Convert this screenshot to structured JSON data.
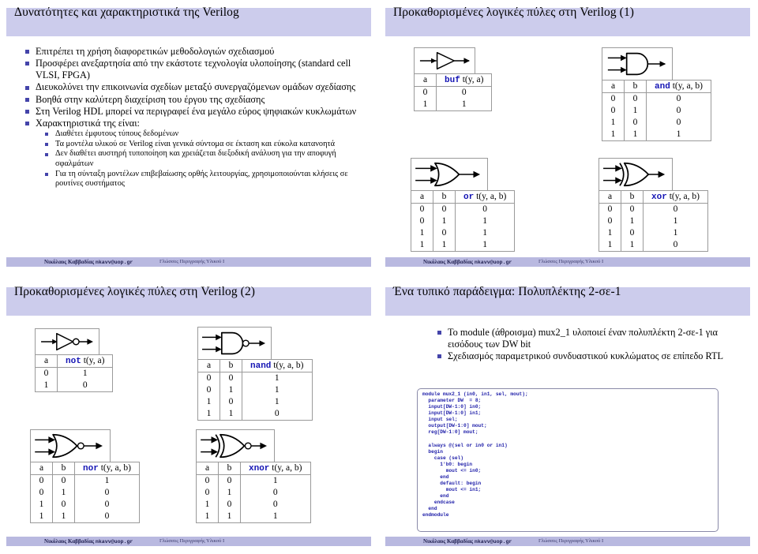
{
  "footer": {
    "author": "Νικόλαος Καββαδίας",
    "email": "nkavv@uop.gr",
    "course": "Γλώσσες Περιγραφής Υλικού Ι"
  },
  "colors": {
    "title_bar": "#ccccec",
    "footer_bar": "#b9b9e0",
    "bullet": "#4444aa",
    "keyword": "#1414b4",
    "code_text": "#2222aa",
    "table_border": "#9a9a9a"
  },
  "slides": [
    {
      "id": "slide-1",
      "title": "Δυνατότητες και χαρακτηριστικά της Verilog",
      "bullets": [
        {
          "level": 1,
          "text": "Επιτρέπει τη χρήση διαφορετικών μεθοδολογιών σχεδιασμού"
        },
        {
          "level": 1,
          "text": "Προσφέρει ανεξαρτησία από την εκάστοτε τεχνολογία υλοποίησης (standard cell VLSI, FPGA)"
        },
        {
          "level": 1,
          "text": "Διευκολύνει την επικοινωνία σχεδίων μεταξύ συνεργαζόμενων ομάδων σχεδίασης"
        },
        {
          "level": 1,
          "text": "Βοηθά στην καλύτερη διαχείριση του έργου της σχεδίασης"
        },
        {
          "level": 1,
          "text": "Στη Verilog HDL μπορεί να περιγραφεί ένα μεγάλο εύρος ψηφιακών κυκλωμάτων"
        },
        {
          "level": 1,
          "text": "Χαρακτηριστικά της είναι:"
        },
        {
          "level": 2,
          "text": "Διαθέτει έμφυτους τύπους δεδομένων"
        },
        {
          "level": 2,
          "text": "Τα μοντέλα υλικού σε Verilog είναι γενικά σύντομα σε έκταση και εύκολα κατανοητά"
        },
        {
          "level": 2,
          "text": "Δεν διαθέτει αυστηρή τυποποίηση και χρειάζεται διεξοδική ανάλυση για την αποφυγή σφαλμάτων"
        },
        {
          "level": 2,
          "text": "Για τη σύνταξη μοντέλων επιβεβαίωσης ορθής λειτουργίας, χρησιμοποιούνται κλήσεις σε ρουτίνες συστήματος"
        }
      ]
    },
    {
      "id": "slide-2",
      "title": "Προκαθορισμένες λογικές πύλες στη Verilog (1)",
      "gates": [
        {
          "name": "buf",
          "shape": "buffer",
          "inputs": 1,
          "header": [
            "a",
            "buf t(y, a)"
          ],
          "keyword": "buf",
          "signature": " t(y, a)",
          "rows": [
            [
              "0",
              "0"
            ],
            [
              "1",
              "1"
            ]
          ]
        },
        {
          "name": "and",
          "shape": "and",
          "inputs": 2,
          "header": [
            "a",
            "b",
            "and t(y, a, b)"
          ],
          "keyword": "and",
          "signature": " t(y, a, b)",
          "rows": [
            [
              "0",
              "0",
              "0"
            ],
            [
              "0",
              "1",
              "0"
            ],
            [
              "1",
              "0",
              "0"
            ],
            [
              "1",
              "1",
              "1"
            ]
          ]
        },
        {
          "name": "or",
          "shape": "or",
          "inputs": 2,
          "header": [
            "a",
            "b",
            "or t(y, a, b)"
          ],
          "keyword": "or",
          "signature": " t(y, a, b)",
          "rows": [
            [
              "0",
              "0",
              "0"
            ],
            [
              "0",
              "1",
              "1"
            ],
            [
              "1",
              "0",
              "1"
            ],
            [
              "1",
              "1",
              "1"
            ]
          ]
        },
        {
          "name": "xor",
          "shape": "xor",
          "inputs": 2,
          "header": [
            "a",
            "b",
            "xor t(y, a, b)"
          ],
          "keyword": "xor",
          "signature": " t(y, a, b)",
          "rows": [
            [
              "0",
              "0",
              "0"
            ],
            [
              "0",
              "1",
              "1"
            ],
            [
              "1",
              "0",
              "1"
            ],
            [
              "1",
              "1",
              "0"
            ]
          ]
        }
      ]
    },
    {
      "id": "slide-3",
      "title": "Προκαθορισμένες λογικές πύλες στη Verilog (2)",
      "gates": [
        {
          "name": "not",
          "shape": "not",
          "inputs": 1,
          "header": [
            "a",
            "not t(y, a)"
          ],
          "keyword": "not",
          "signature": " t(y, a)",
          "rows": [
            [
              "0",
              "1"
            ],
            [
              "1",
              "0"
            ]
          ]
        },
        {
          "name": "nand",
          "shape": "nand",
          "inputs": 2,
          "header": [
            "a",
            "b",
            "nand t(y, a, b)"
          ],
          "keyword": "nand",
          "signature": " t(y, a, b)",
          "rows": [
            [
              "0",
              "0",
              "1"
            ],
            [
              "0",
              "1",
              "1"
            ],
            [
              "1",
              "0",
              "1"
            ],
            [
              "1",
              "1",
              "0"
            ]
          ]
        },
        {
          "name": "nor",
          "shape": "nor",
          "inputs": 2,
          "header": [
            "a",
            "b",
            "nor t(y, a, b)"
          ],
          "keyword": "nor",
          "signature": " t(y, a, b)",
          "rows": [
            [
              "0",
              "0",
              "1"
            ],
            [
              "0",
              "1",
              "0"
            ],
            [
              "1",
              "0",
              "0"
            ],
            [
              "1",
              "1",
              "0"
            ]
          ]
        },
        {
          "name": "xnor",
          "shape": "xnor",
          "inputs": 2,
          "header": [
            "a",
            "b",
            "xnor t(y, a, b)"
          ],
          "keyword": "xnor",
          "signature": " t(y, a, b)",
          "rows": [
            [
              "0",
              "0",
              "1"
            ],
            [
              "0",
              "1",
              "0"
            ],
            [
              "1",
              "0",
              "0"
            ],
            [
              "1",
              "1",
              "1"
            ]
          ]
        }
      ]
    },
    {
      "id": "slide-4",
      "title": "Ένα τυπικό παράδειγμα: Πολυπλέκτης 2-σε-1",
      "bullets": [
        {
          "level": 1,
          "text": "Το module (άθροισμα) mux2_1 υλοποιεί έναν πολυπλέκτη 2-σε-1 για εισόδους των DW bit"
        },
        {
          "level": 1,
          "text": "Σχεδιασμός παραμετρικού συνδυαστικού κυκλώματος σε επίπεδο RTL"
        }
      ],
      "code": "module mux2_1 (in0, in1, sel, mout);\n  parameter DW  = 8;\n  input[DW-1:0] in0;\n  input[DW-1:0] in1;\n  input sel;\n  output[DW-1:0] mout;\n  reg[DW-1:0] mout;\n\n  always @(sel or in0 or in1)\n  begin\n    case (sel)\n      1'b0: begin\n        mout <= in0;\n      end\n      default: begin\n        mout <= in1;\n      end\n    endcase\n  end\nendmodule"
    }
  ]
}
